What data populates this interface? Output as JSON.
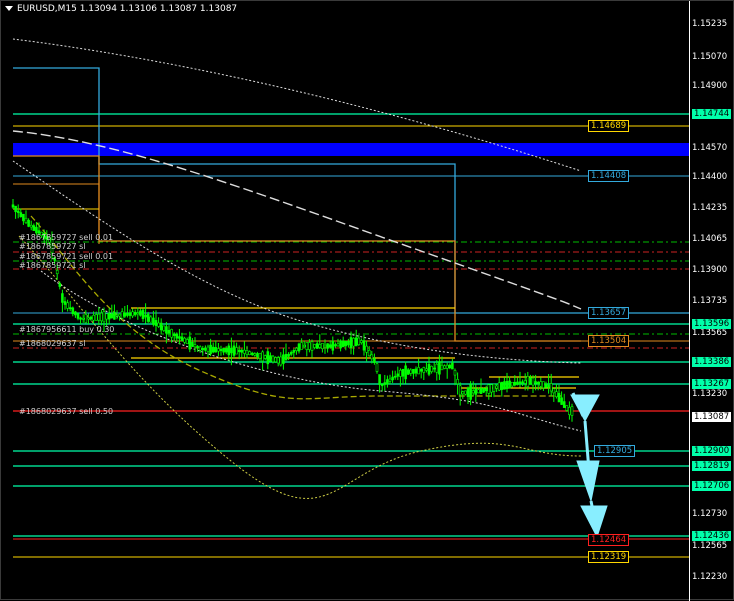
{
  "window": {
    "symbol_info": "EURUSD,M15  1.13094 1.13106 1.13087 1.13087"
  },
  "colors": {
    "background": "#000000",
    "candles": "#00ff00",
    "aqua_line": "#00ffaa",
    "blue_band": "#0000ff",
    "orange_line": "#e08a1e",
    "yellow_line": "#ffd700",
    "cyan_line": "#33aadd",
    "red_line": "#ff2020",
    "arrow": "#88eeff"
  },
  "price_axis": {
    "ticks": [
      "1.15235",
      "1.15070",
      "1.14900",
      "1.14744",
      "1.14570",
      "1.14400",
      "1.14235",
      "1.14065",
      "1.13900",
      "1.13735",
      "1.13565",
      "1.13396",
      "1.13230",
      "1.13087",
      "1.12900",
      "1.12730",
      "1.12565",
      "1.12395",
      "1.12230"
    ],
    "boxed": [
      {
        "text": "1.14744",
        "color": "#00ffaa"
      },
      {
        "text": "1.13596",
        "color": "#00ffaa"
      },
      {
        "text": "1.13386",
        "color": "#00ffaa"
      },
      {
        "text": "1.13267",
        "color": "#00ffaa"
      },
      {
        "text": "1.13087",
        "color": "#ffffff"
      },
      {
        "text": "1.12900",
        "color": "#00ffaa"
      },
      {
        "text": "1.12819",
        "color": "#00ffaa"
      },
      {
        "text": "1.12706",
        "color": "#00ffaa"
      },
      {
        "text": "1.12436",
        "color": "#00ffaa"
      }
    ]
  },
  "line_labels": [
    {
      "text": "1.14689",
      "color": "#ffd700"
    },
    {
      "text": "1.14408",
      "color": "#33aadd"
    },
    {
      "text": "1.13657",
      "color": "#33aadd"
    },
    {
      "text": "1.13504",
      "color": "#e08a1e"
    },
    {
      "text": "1.12905",
      "color": "#33aadd"
    },
    {
      "text": "1.12464",
      "color": "#ff2020"
    },
    {
      "text": "1.12319",
      "color": "#ffd700"
    }
  ],
  "orders": [
    "#1867859727 sell 0.01",
    "#1867859727 sl",
    "#1867859721 sell 0.01",
    "#1867859721 sl",
    "#1867956611 buy 0.30",
    "#1868029637 sl",
    "#1868029637 sell 0.50"
  ]
}
